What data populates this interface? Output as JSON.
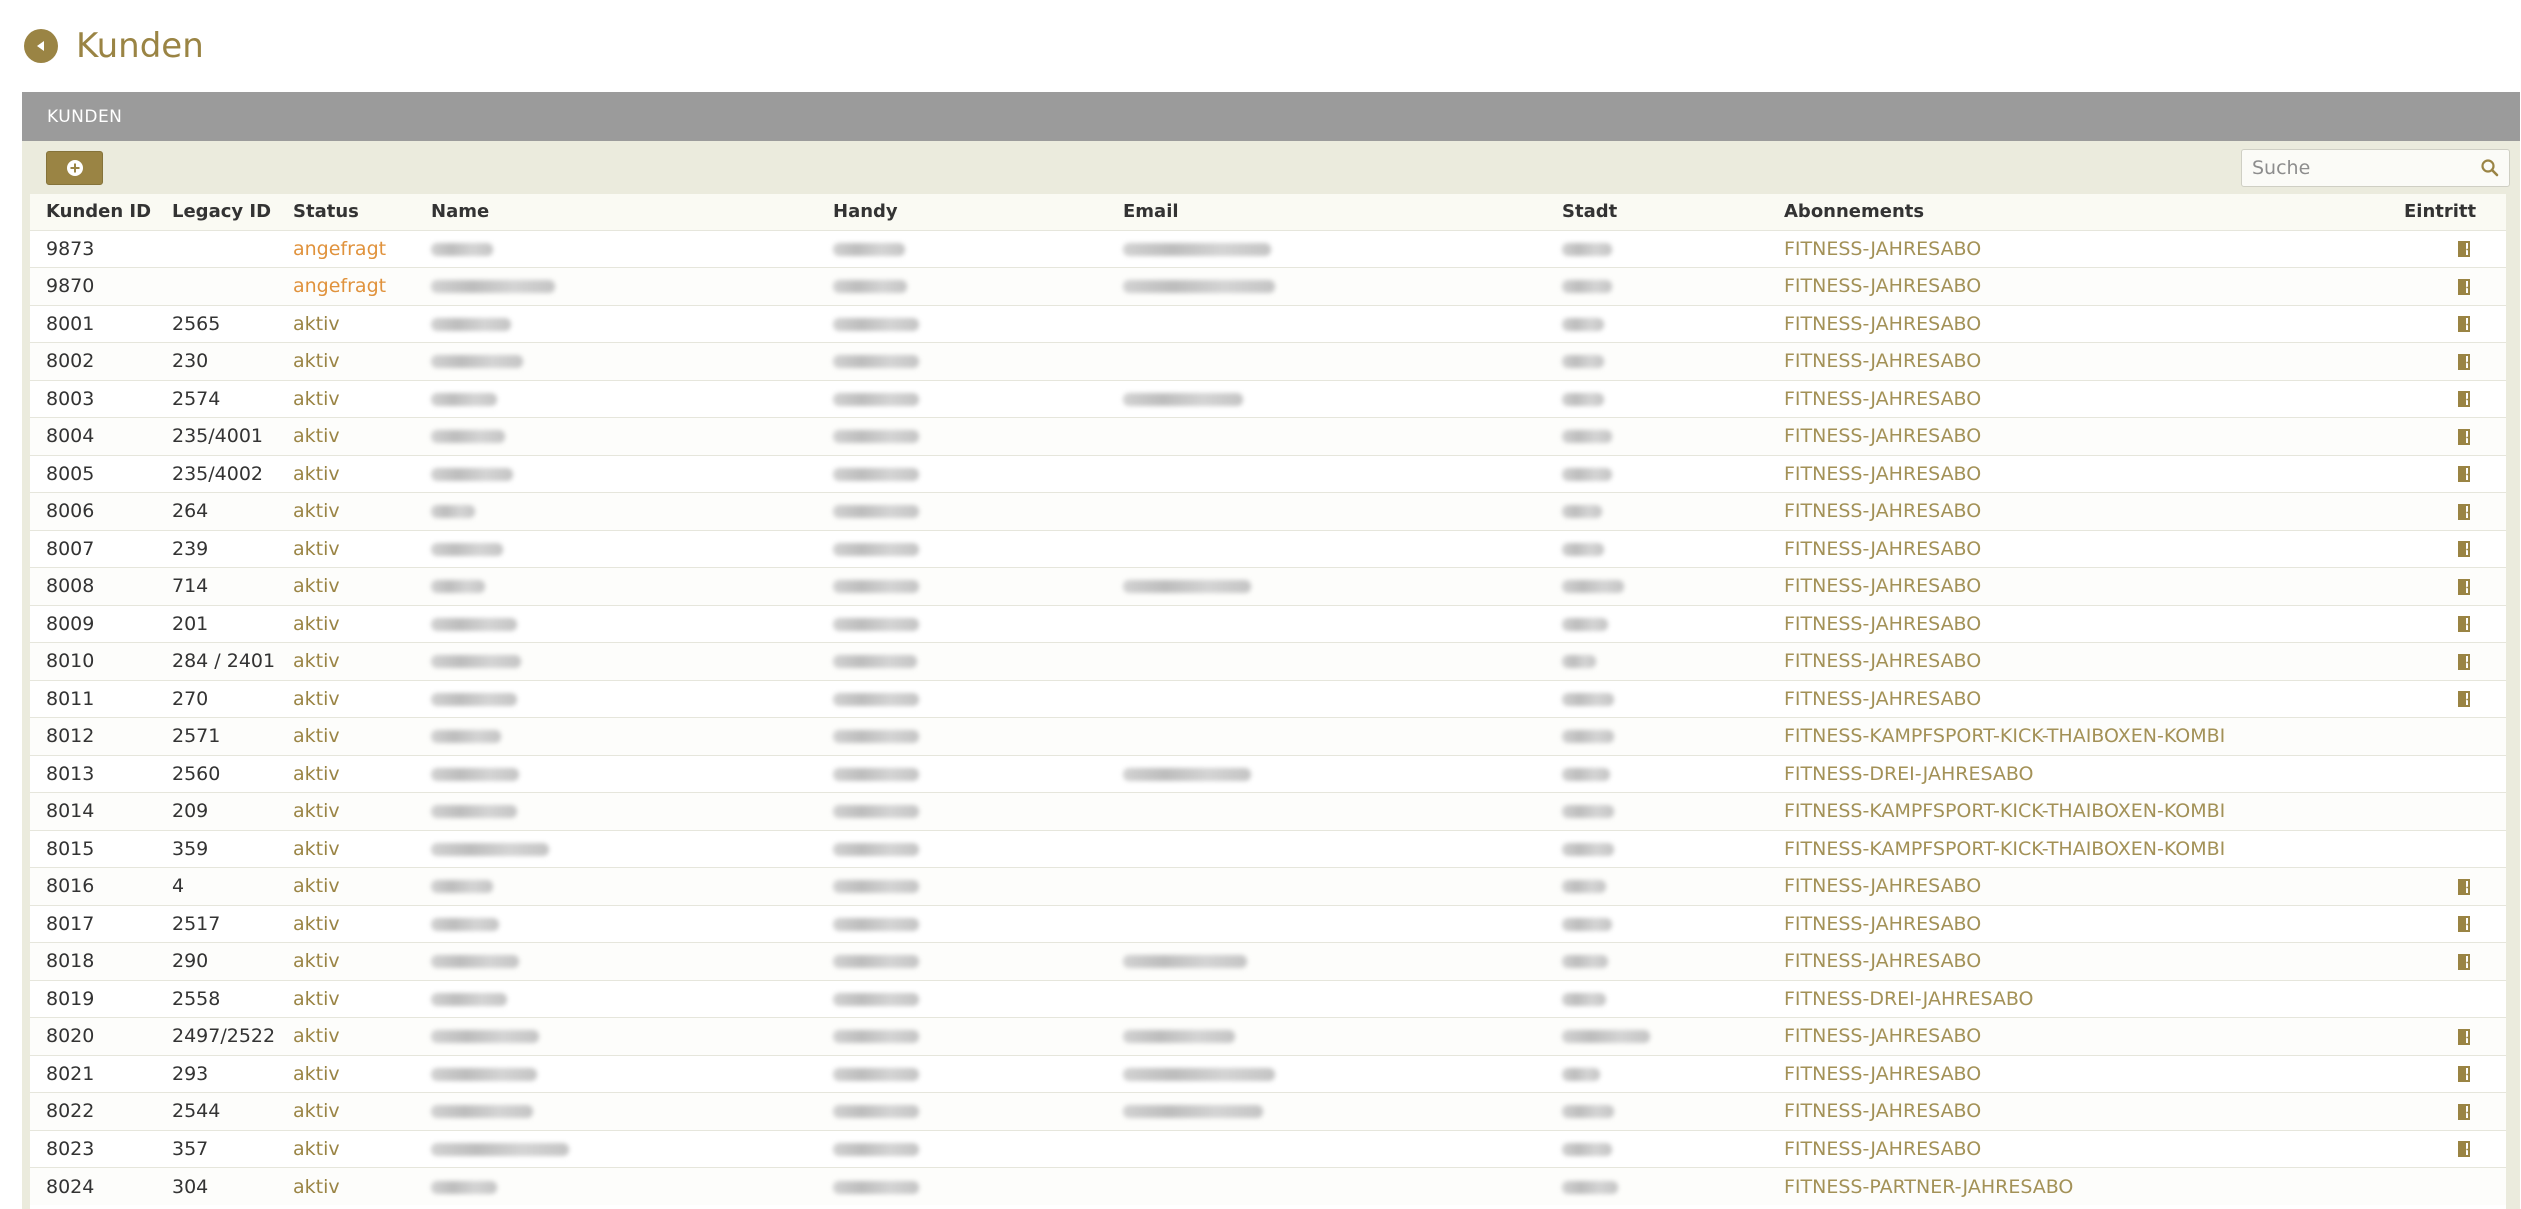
{
  "page": {
    "title": "Kunden"
  },
  "panel": {
    "heading": "KUNDEN"
  },
  "search": {
    "placeholder": "Suche"
  },
  "colors": {
    "accent": "#9a8444",
    "status_pending": "#e0923c",
    "status_active": "#9a8444",
    "panel_heading_bg": "#9b9b9b",
    "panel_bg": "#ebebdd"
  },
  "icons": {
    "back": "back-arrow-icon",
    "add": "plus-circle-icon",
    "search": "magnifier-icon",
    "entry": "door-icon"
  },
  "table": {
    "columns": [
      "Kunden ID",
      "Legacy ID",
      "Status",
      "Name",
      "Handy",
      "Email",
      "Stadt",
      "Abonnements",
      "Eintritt"
    ],
    "rows": [
      {
        "id": "9873",
        "legacy": "",
        "status": "angefragt",
        "abo": "FITNESS-JAHRESABO",
        "eintritt": true
      },
      {
        "id": "9870",
        "legacy": "",
        "status": "angefragt",
        "abo": "FITNESS-JAHRESABO",
        "eintritt": true
      },
      {
        "id": "8001",
        "legacy": "2565",
        "status": "aktiv",
        "abo": "FITNESS-JAHRESABO",
        "eintritt": true
      },
      {
        "id": "8002",
        "legacy": "230",
        "status": "aktiv",
        "abo": "FITNESS-JAHRESABO",
        "eintritt": true
      },
      {
        "id": "8003",
        "legacy": "2574",
        "status": "aktiv",
        "abo": "FITNESS-JAHRESABO",
        "eintritt": true
      },
      {
        "id": "8004",
        "legacy": "235/4001",
        "status": "aktiv",
        "abo": "FITNESS-JAHRESABO",
        "eintritt": true
      },
      {
        "id": "8005",
        "legacy": "235/4002",
        "status": "aktiv",
        "abo": "FITNESS-JAHRESABO",
        "eintritt": true
      },
      {
        "id": "8006",
        "legacy": "264",
        "status": "aktiv",
        "abo": "FITNESS-JAHRESABO",
        "eintritt": true
      },
      {
        "id": "8007",
        "legacy": "239",
        "status": "aktiv",
        "abo": "FITNESS-JAHRESABO",
        "eintritt": true
      },
      {
        "id": "8008",
        "legacy": "714",
        "status": "aktiv",
        "abo": "FITNESS-JAHRESABO",
        "eintritt": true
      },
      {
        "id": "8009",
        "legacy": "201",
        "status": "aktiv",
        "abo": "FITNESS-JAHRESABO",
        "eintritt": true
      },
      {
        "id": "8010",
        "legacy": "284 / 2401",
        "status": "aktiv",
        "abo": "FITNESS-JAHRESABO",
        "eintritt": true
      },
      {
        "id": "8011",
        "legacy": "270",
        "status": "aktiv",
        "abo": "FITNESS-JAHRESABO",
        "eintritt": true
      },
      {
        "id": "8012",
        "legacy": "2571",
        "status": "aktiv",
        "abo": "FITNESS-KAMPFSPORT-KICK-THAIBOXEN-KOMBI",
        "eintritt": false
      },
      {
        "id": "8013",
        "legacy": "2560",
        "status": "aktiv",
        "abo": "FITNESS-DREI-JAHRESABO",
        "eintritt": false
      },
      {
        "id": "8014",
        "legacy": "209",
        "status": "aktiv",
        "abo": "FITNESS-KAMPFSPORT-KICK-THAIBOXEN-KOMBI",
        "eintritt": false
      },
      {
        "id": "8015",
        "legacy": "359",
        "status": "aktiv",
        "abo": "FITNESS-KAMPFSPORT-KICK-THAIBOXEN-KOMBI",
        "eintritt": false
      },
      {
        "id": "8016",
        "legacy": "4",
        "status": "aktiv",
        "abo": "FITNESS-JAHRESABO",
        "eintritt": true
      },
      {
        "id": "8017",
        "legacy": "2517",
        "status": "aktiv",
        "abo": "FITNESS-JAHRESABO",
        "eintritt": true
      },
      {
        "id": "8018",
        "legacy": "290",
        "status": "aktiv",
        "abo": "FITNESS-JAHRESABO",
        "eintritt": true
      },
      {
        "id": "8019",
        "legacy": "2558",
        "status": "aktiv",
        "abo": "FITNESS-DREI-JAHRESABO",
        "eintritt": false
      },
      {
        "id": "8020",
        "legacy": "2497/2522",
        "status": "aktiv",
        "abo": "FITNESS-JAHRESABO",
        "eintritt": true
      },
      {
        "id": "8021",
        "legacy": "293",
        "status": "aktiv",
        "abo": "FITNESS-JAHRESABO",
        "eintritt": true
      },
      {
        "id": "8022",
        "legacy": "2544",
        "status": "aktiv",
        "abo": "FITNESS-JAHRESABO",
        "eintritt": true
      },
      {
        "id": "8023",
        "legacy": "357",
        "status": "aktiv",
        "abo": "FITNESS-JAHRESABO",
        "eintritt": true
      },
      {
        "id": "8024",
        "legacy": "304",
        "status": "aktiv",
        "abo": "FITNESS-PARTNER-JAHRESABO",
        "eintritt": false
      }
    ]
  }
}
